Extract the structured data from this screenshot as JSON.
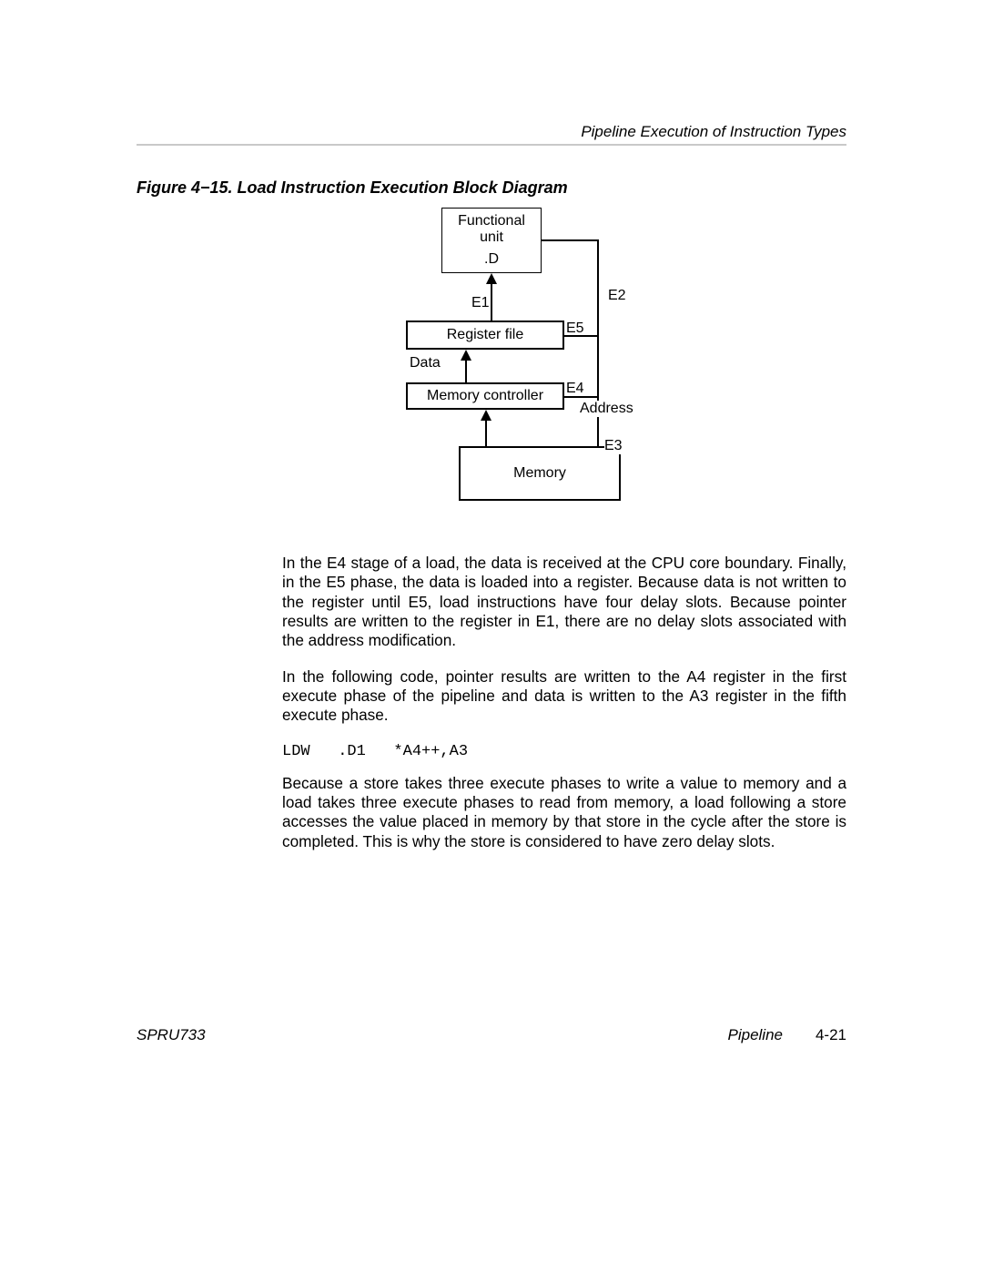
{
  "header": {
    "running_title": "Pipeline Execution of Instruction Types"
  },
  "figure": {
    "caption": "Figure 4−15. Load Instruction Execution Block Diagram",
    "boxes": {
      "functional_unit_line1": "Functional",
      "functional_unit_line2": "unit",
      "functional_unit_line3": ".D",
      "register_file": "Register file",
      "memory_controller": "Memory controller",
      "memory": "Memory"
    },
    "labels": {
      "E1": "E1",
      "E2": "E2",
      "E3": "E3",
      "E4": "E4",
      "E5": "E5",
      "Data": "Data",
      "Address": "Address"
    }
  },
  "paragraphs": {
    "p1": "In the E4 stage of a load, the data is received at the CPU core boundary. Finally, in the E5 phase, the data is loaded into a register. Because data is not written to the register until E5, load instructions have four delay slots. Because pointer results are written to the register in E1, there are no delay slots associated with the address modification.",
    "p2": "In the following code, pointer results are written to the A4 register in the first execute phase of the pipeline and data is written to the A3 register in the fifth execute phase.",
    "code": "LDW   .D1   *A4++,A3",
    "p3": "Because a store takes three execute phases to write a value to memory and a load takes three execute phases to read from memory, a load following a store accesses the value placed in memory by that store in the cycle after the store is completed. This is why the store is considered to have zero delay slots."
  },
  "footer": {
    "doc_id": "SPRU733",
    "section": "Pipeline",
    "page": "4-21"
  }
}
